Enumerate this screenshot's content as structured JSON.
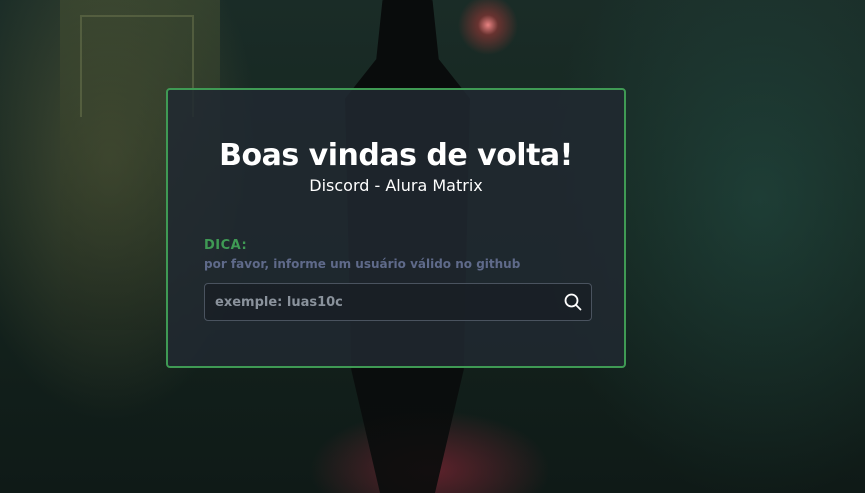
{
  "card": {
    "title": "Boas vindas de volta!",
    "subtitle": "Discord - Alura Matrix"
  },
  "hint": {
    "label": "DICA:",
    "text": "por favor, informe um usuário válido no github"
  },
  "search": {
    "placeholder": "exemple: luas10c",
    "value": "",
    "icon": "search-icon"
  },
  "colors": {
    "accent": "#3f9a54",
    "hint_text": "#5f6a8a",
    "card_background": "#212931"
  }
}
